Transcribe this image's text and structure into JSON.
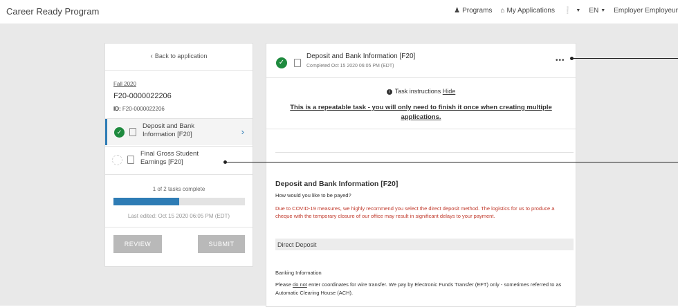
{
  "app": {
    "title": "Career Ready Program"
  },
  "nav": {
    "programs": "Programs",
    "my_applications": "My Applications",
    "language": "EN",
    "user": "Employer Employeur"
  },
  "sidebar": {
    "back_label": "Back to application",
    "term": "Fall 2020",
    "app_number": "F20-0000022206",
    "id_label": "ID:",
    "id_value": "F20-0000022206",
    "tasks": [
      {
        "label": "Deposit and Bank Information [F20]",
        "status": "complete"
      },
      {
        "label": "Final Gross Student Earnings [F20]",
        "status": "incomplete"
      }
    ],
    "progress_text": "1 of 2 tasks complete",
    "progress_fraction": 0.5,
    "last_edited": "Last edited: Oct 15 2020 06:05 PM (EDT)",
    "review_label": "REVIEW",
    "submit_label": "SUBMIT"
  },
  "task_panel": {
    "title": "Deposit and Bank Information [F20]",
    "completed": "Completed Oct 15 2020 06:05 PM (EDT)",
    "more": "•••",
    "instructions_label": "Task instructions",
    "hide_label": "Hide",
    "repeatable_notice": "This is a repeatable task - you will only need to finish it once when creating multiple applications.",
    "section_title": "Deposit and Bank Information [F20]",
    "question": "How would you like to be payed?",
    "covid_notice": "Due to COVID-19 measures, we highly recommend you select the direct deposit method. The logistics for us to produce a cheque with the temporary closure of our office may result in significant delays to your payment.",
    "deposit_method": "Direct Deposit",
    "banking_title": "Banking Information",
    "banking_text_pre": "Please",
    "banking_text_emph": "do not",
    "banking_text_post": "enter coordinates for wire transfer. We pay by Electronic Funds Transfer (EFT) only - sometimes referred to as Automatic Clearing House (ACH)."
  },
  "colors": {
    "accent": "#2e7cb5",
    "success": "#1e8a3e",
    "warning": "#c0392b"
  }
}
